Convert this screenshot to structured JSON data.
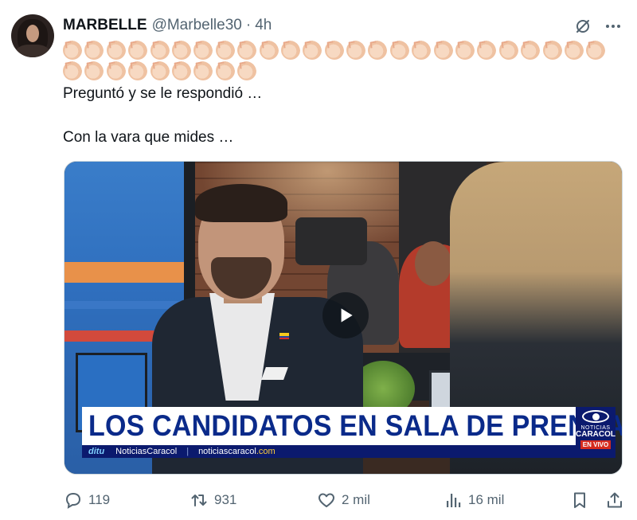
{
  "tweet": {
    "display_name": "MARBELLE",
    "handle": "@Marbelle30",
    "separator": "·",
    "time": "4h",
    "claps_line1": "👏👏👏👏👏👏👏👏👏👏👏👏👏👏👏👏👏👏👏👏👏👏👏👏👏",
    "claps_line2": "👏👏👏👏👏👏👏👏👏",
    "text_line1": "Preguntó y se le respondió …",
    "text_line2": "Con la vara que mides …"
  },
  "video": {
    "headline": "LOS CANDIDATOS EN SALA DE PRENSA",
    "ticker_brand": "ditu",
    "ticker_source": "NoticiasCaracol",
    "ticker_separator": "|",
    "ticker_url_a": "noticiascaracol",
    "ticker_url_b": ".com",
    "logo_line1": "NOTICIAS",
    "logo_line2": "CARACOL",
    "logo_live": "EN VIVO"
  },
  "metrics": {
    "replies": "119",
    "reposts": "931",
    "likes": "2 mil",
    "views": "16 mil"
  },
  "icons": {
    "more": "more-horizontal-icon",
    "grok": "grok-icon",
    "reply": "reply-icon",
    "repost": "repost-icon",
    "like": "heart-icon",
    "views": "views-icon",
    "bookmark": "bookmark-icon",
    "share": "share-icon"
  }
}
